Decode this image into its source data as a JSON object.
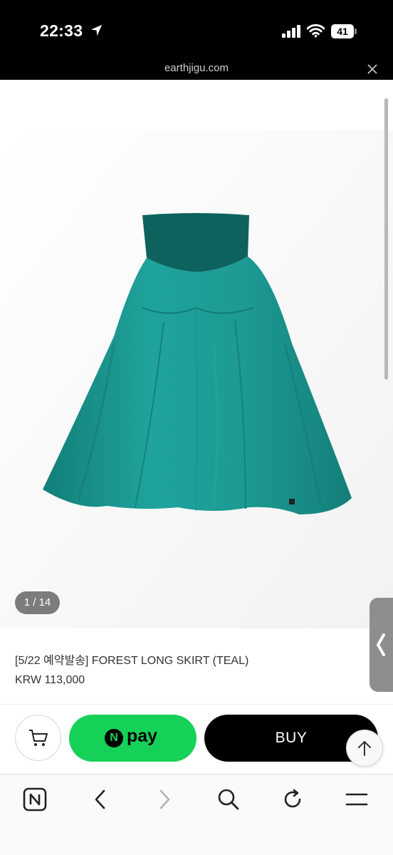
{
  "status_bar": {
    "time": "22:33",
    "battery": "41"
  },
  "browser": {
    "url": "earthjigu.com"
  },
  "gallery": {
    "counter": "1 / 14"
  },
  "product": {
    "title": "[5/22 예약발송] FOREST LONG SKIRT (TEAL)",
    "price": "KRW 113,000",
    "color": "#1d9a94"
  },
  "purchase_bar": {
    "npay_badge": "N",
    "npay_label": "pay",
    "buy_label": "BUY"
  },
  "colors": {
    "npay_green": "#16d158",
    "buy_black": "#000000"
  },
  "icons": [
    "location-arrow-icon",
    "signal-icon",
    "wifi-icon",
    "battery-icon",
    "close-icon",
    "cart-icon",
    "arrow-up-icon",
    "naver-home-icon",
    "back-icon",
    "forward-icon",
    "search-icon",
    "refresh-icon",
    "menu-icon",
    "chevron-left-icon"
  ]
}
